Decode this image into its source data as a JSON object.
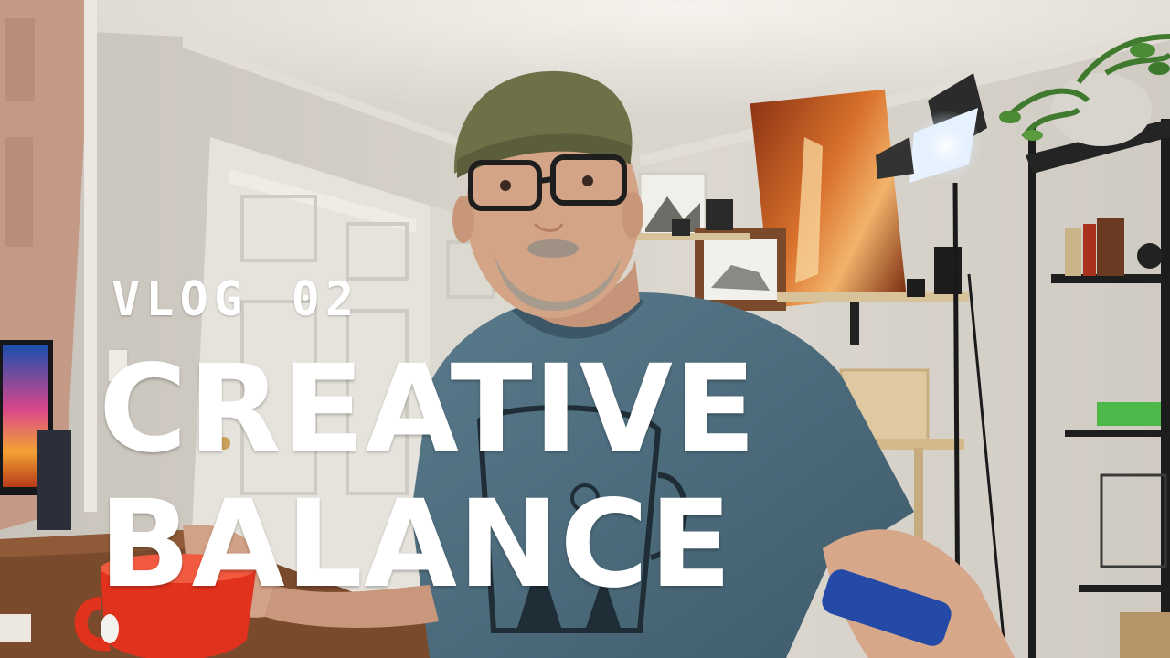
{
  "thumbnail": {
    "series_label": "VLOG 02",
    "headline_line1": "CREATIVE",
    "headline_line2": "BALANCE"
  },
  "colors": {
    "wall": "#d8d3cb",
    "ceiling": "#ece8e1",
    "door": "#e9e7e1",
    "shirt": "#4f6f80",
    "cap": "#6f7048",
    "mug": "#e0321c",
    "desk": "#7a4a2c",
    "canyon_print": "#b9541f",
    "text": "#ffffff"
  }
}
